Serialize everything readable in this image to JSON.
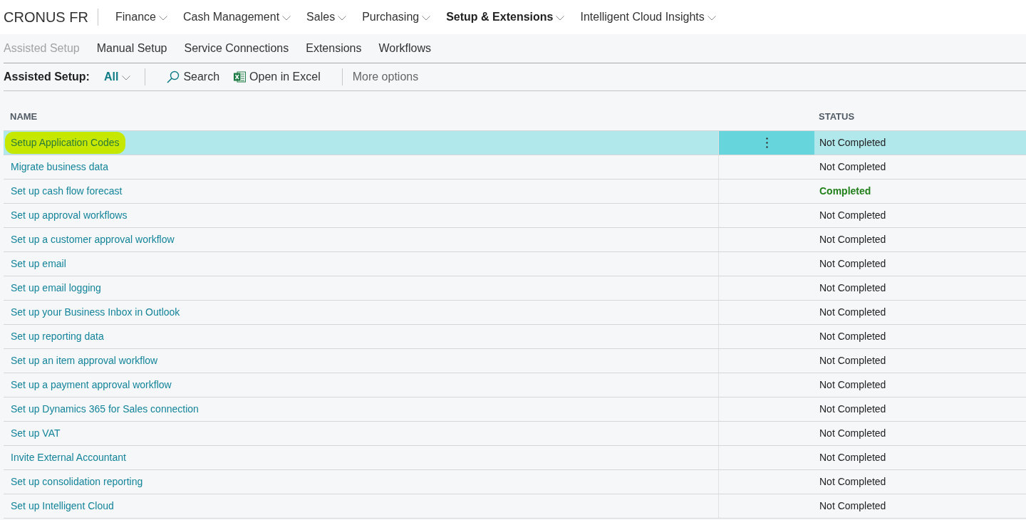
{
  "app": {
    "company": "CRONUS FR"
  },
  "nav": [
    {
      "label": "Finance",
      "selected": false
    },
    {
      "label": "Cash Management",
      "selected": false
    },
    {
      "label": "Sales",
      "selected": false
    },
    {
      "label": "Purchasing",
      "selected": false
    },
    {
      "label": "Setup & Extensions",
      "selected": true
    },
    {
      "label": "Intelligent Cloud Insights",
      "selected": false
    }
  ],
  "subnav": [
    {
      "label": "Assisted Setup",
      "disabled": true
    },
    {
      "label": "Manual Setup",
      "disabled": false
    },
    {
      "label": "Service Connections",
      "disabled": false
    },
    {
      "label": "Extensions",
      "disabled": false
    },
    {
      "label": "Workflows",
      "disabled": false
    }
  ],
  "action_bar": {
    "title": "Assisted Setup:",
    "filter": "All",
    "actions": [
      {
        "label": "Search",
        "kind": "search"
      },
      {
        "label": "Open in Excel",
        "kind": "excel"
      }
    ],
    "more": "More options"
  },
  "table": {
    "columns": [
      "NAME",
      "STATUS"
    ],
    "rows": [
      {
        "name": "Setup Application Codes",
        "status": "Not Completed",
        "completed": false,
        "selected": true,
        "highlighted": true
      },
      {
        "name": "Migrate business data",
        "status": "Not Completed",
        "completed": false,
        "selected": false,
        "highlighted": false
      },
      {
        "name": "Set up cash flow forecast",
        "status": "Completed",
        "completed": true,
        "selected": false,
        "highlighted": false
      },
      {
        "name": "Set up approval workflows",
        "status": "Not Completed",
        "completed": false,
        "selected": false,
        "highlighted": false
      },
      {
        "name": "Set up a customer approval workflow",
        "status": "Not Completed",
        "completed": false,
        "selected": false,
        "highlighted": false
      },
      {
        "name": "Set up email",
        "status": "Not Completed",
        "completed": false,
        "selected": false,
        "highlighted": false
      },
      {
        "name": "Set up email logging",
        "status": "Not Completed",
        "completed": false,
        "selected": false,
        "highlighted": false
      },
      {
        "name": "Set up your Business Inbox in Outlook",
        "status": "Not Completed",
        "completed": false,
        "selected": false,
        "highlighted": false
      },
      {
        "name": "Set up reporting data",
        "status": "Not Completed",
        "completed": false,
        "selected": false,
        "highlighted": false
      },
      {
        "name": "Set up an item approval workflow",
        "status": "Not Completed",
        "completed": false,
        "selected": false,
        "highlighted": false
      },
      {
        "name": "Set up a payment approval workflow",
        "status": "Not Completed",
        "completed": false,
        "selected": false,
        "highlighted": false
      },
      {
        "name": "Set up Dynamics 365 for Sales connection",
        "status": "Not Completed",
        "completed": false,
        "selected": false,
        "highlighted": false
      },
      {
        "name": "Set up VAT",
        "status": "Not Completed",
        "completed": false,
        "selected": false,
        "highlighted": false
      },
      {
        "name": "Invite External Accountant",
        "status": "Not Completed",
        "completed": false,
        "selected": false,
        "highlighted": false
      },
      {
        "name": "Set up consolidation reporting",
        "status": "Not Completed",
        "completed": false,
        "selected": false,
        "highlighted": false
      },
      {
        "name": "Set up Intelligent Cloud",
        "status": "Not Completed",
        "completed": false,
        "selected": false,
        "highlighted": false
      }
    ]
  }
}
